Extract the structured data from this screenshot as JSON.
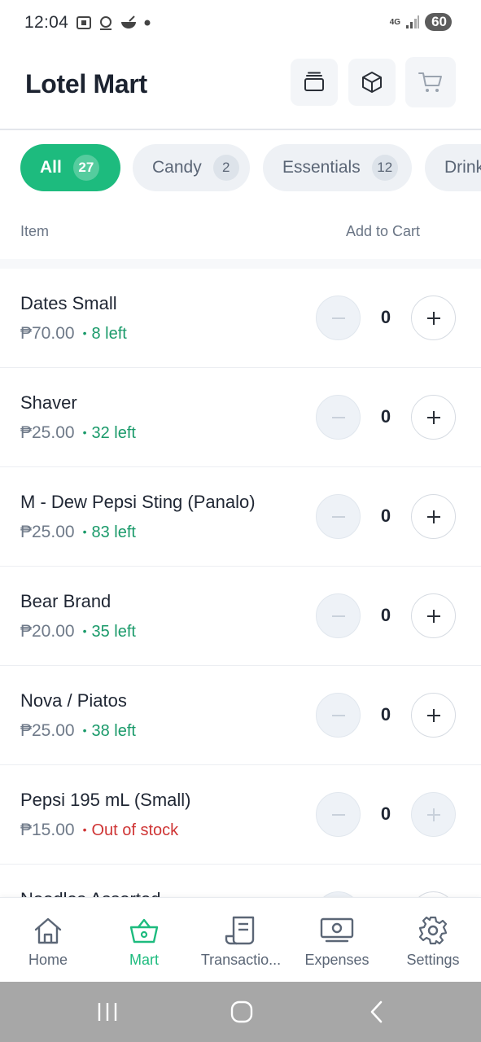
{
  "status": {
    "time": "12:04",
    "network": "4G",
    "battery": "60"
  },
  "header": {
    "title": "Lotel Mart"
  },
  "filters": [
    {
      "label": "All",
      "count": "27",
      "active": true
    },
    {
      "label": "Candy",
      "count": "2",
      "active": false
    },
    {
      "label": "Essentials",
      "count": "12",
      "active": false
    },
    {
      "label": "Drinks",
      "count": "",
      "active": false
    }
  ],
  "columns": {
    "item": "Item",
    "add_to_cart": "Add to Cart"
  },
  "products": [
    {
      "name": "Dates Small",
      "price": "₱70.00",
      "stock": "8 left",
      "in_stock": true,
      "qty": "0"
    },
    {
      "name": "Shaver",
      "price": "₱25.00",
      "stock": "32 left",
      "in_stock": true,
      "qty": "0"
    },
    {
      "name": "M - Dew Pepsi Sting (Panalo)",
      "price": "₱25.00",
      "stock": "83 left",
      "in_stock": true,
      "qty": "0"
    },
    {
      "name": "Bear Brand",
      "price": "₱20.00",
      "stock": "35 left",
      "in_stock": true,
      "qty": "0"
    },
    {
      "name": "Nova / Piatos",
      "price": "₱25.00",
      "stock": "38 left",
      "in_stock": true,
      "qty": "0"
    },
    {
      "name": "Pepsi 195 mL (Small)",
      "price": "₱15.00",
      "stock": "Out of stock",
      "in_stock": false,
      "qty": "0"
    },
    {
      "name": "Noodles Assorted",
      "price": "",
      "stock": "",
      "in_stock": true,
      "qty": ""
    }
  ],
  "nav": [
    {
      "label": "Home",
      "icon": "home-icon",
      "active": false
    },
    {
      "label": "Mart",
      "icon": "basket-icon",
      "active": true
    },
    {
      "label": "Transactio...",
      "icon": "receipt-icon",
      "active": false
    },
    {
      "label": "Expenses",
      "icon": "banknote-icon",
      "active": false
    },
    {
      "label": "Settings",
      "icon": "gear-icon",
      "active": false
    }
  ],
  "colors": {
    "accent": "#1dbb7e",
    "in_stock": "#1a9a6a",
    "out_of_stock": "#cf3535"
  }
}
